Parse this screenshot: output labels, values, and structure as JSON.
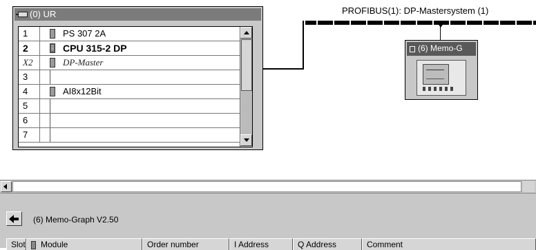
{
  "rack": {
    "title": "(0) UR",
    "rows": [
      {
        "slot": "1",
        "module": "PS 307 2A",
        "style": "normal"
      },
      {
        "slot": "2",
        "module": "CPU 315-2 DP",
        "style": "bold"
      },
      {
        "slot": "X2",
        "module": "DP-Master",
        "style": "italic"
      },
      {
        "slot": "3",
        "module": "",
        "style": "normal"
      },
      {
        "slot": "4",
        "module": "AI8x12Bit",
        "style": "normal"
      },
      {
        "slot": "5",
        "module": "",
        "style": "normal"
      },
      {
        "slot": "6",
        "module": "",
        "style": "normal"
      },
      {
        "slot": "7",
        "module": "",
        "style": "normal"
      }
    ]
  },
  "network": {
    "bus_label": "PROFIBUS(1): DP-Mastersystem (1)"
  },
  "device": {
    "title": "(6) Memo-G"
  },
  "details": {
    "caption": "(6)   Memo-Graph V2.50",
    "columns": [
      "Slot",
      "Module",
      "Order number",
      "I Address",
      "Q Address",
      "Comment"
    ]
  }
}
